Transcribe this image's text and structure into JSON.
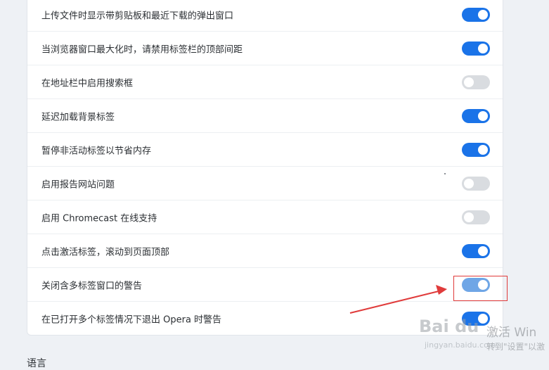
{
  "settings": {
    "rows": [
      {
        "label": "上传文件时显示带剪贴板和最近下载的弹出窗口",
        "enabled": true
      },
      {
        "label": "当浏览器窗口最大化时，请禁用标签栏的顶部间距",
        "enabled": true
      },
      {
        "label": "在地址栏中启用搜索框",
        "enabled": false
      },
      {
        "label": "延迟加载背景标签",
        "enabled": true
      },
      {
        "label": "暂停非活动标签以节省内存",
        "enabled": true
      },
      {
        "label": "启用报告网站问题",
        "enabled": false
      },
      {
        "label": "启用 Chromecast 在线支持",
        "enabled": false
      },
      {
        "label": "点击激活标签，滚动到页面顶部",
        "enabled": true
      },
      {
        "label": "关闭含多标签窗口的警告",
        "enabled": true
      },
      {
        "label": "在已打开多个标签情况下退出 Opera 时警告",
        "enabled": true
      }
    ]
  },
  "next_section": {
    "title": "语言"
  },
  "annotation": {
    "color": "#e03b3b"
  },
  "watermark": {
    "brand": "Bai du",
    "brand_sub": "jingyan.baidu.com",
    "overlay_line1": "激活 Win",
    "overlay_line2": "转到\"设置\"以激"
  },
  "colors": {
    "toggle_on": "#1a73e8",
    "toggle_off": "#d9dce0"
  }
}
